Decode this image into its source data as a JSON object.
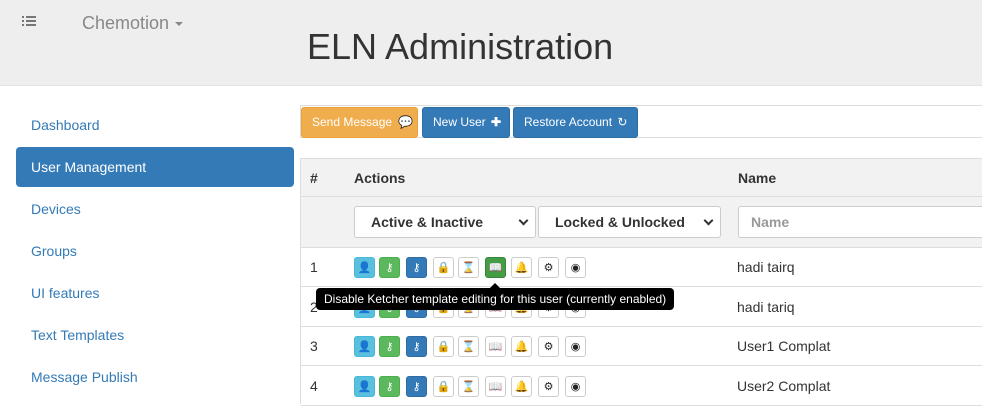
{
  "header": {
    "brand": "Chemotion",
    "title": "ELN Administration"
  },
  "sidebar": {
    "items": [
      {
        "label": "Dashboard",
        "active": false
      },
      {
        "label": "User Management",
        "active": true
      },
      {
        "label": "Devices",
        "active": false
      },
      {
        "label": "Groups",
        "active": false
      },
      {
        "label": "UI features",
        "active": false
      },
      {
        "label": "Text Templates",
        "active": false
      },
      {
        "label": "Message Publish",
        "active": false
      }
    ]
  },
  "toolbar": {
    "send_message": "Send Message",
    "new_user": "New User",
    "restore_account": "Restore Account"
  },
  "table": {
    "columns": {
      "num": "#",
      "actions": "Actions",
      "name": "Name"
    },
    "filters": {
      "active": "Active & Inactive",
      "locked": "Locked & Unlocked",
      "name_placeholder": "Name"
    },
    "rows": [
      {
        "num": "1",
        "name": "hadi tairq"
      },
      {
        "num": "2",
        "name": "hadi tariq"
      },
      {
        "num": "3",
        "name": "User1 Complat"
      },
      {
        "num": "4",
        "name": "User2 Complat"
      }
    ],
    "action_icons": [
      "user-icon",
      "key-icon",
      "key-icon",
      "lock-icon",
      "hourglass-icon",
      "book-icon",
      "bell-icon",
      "gear-icon",
      "user-circle-icon"
    ]
  },
  "tooltip": {
    "text": "Disable Ketcher template editing for this user (currently enabled)"
  },
  "colors": {
    "primary": "#337ab7",
    "warning": "#f0ad4e",
    "success": "#5cb85c",
    "info": "#5bc0de"
  }
}
